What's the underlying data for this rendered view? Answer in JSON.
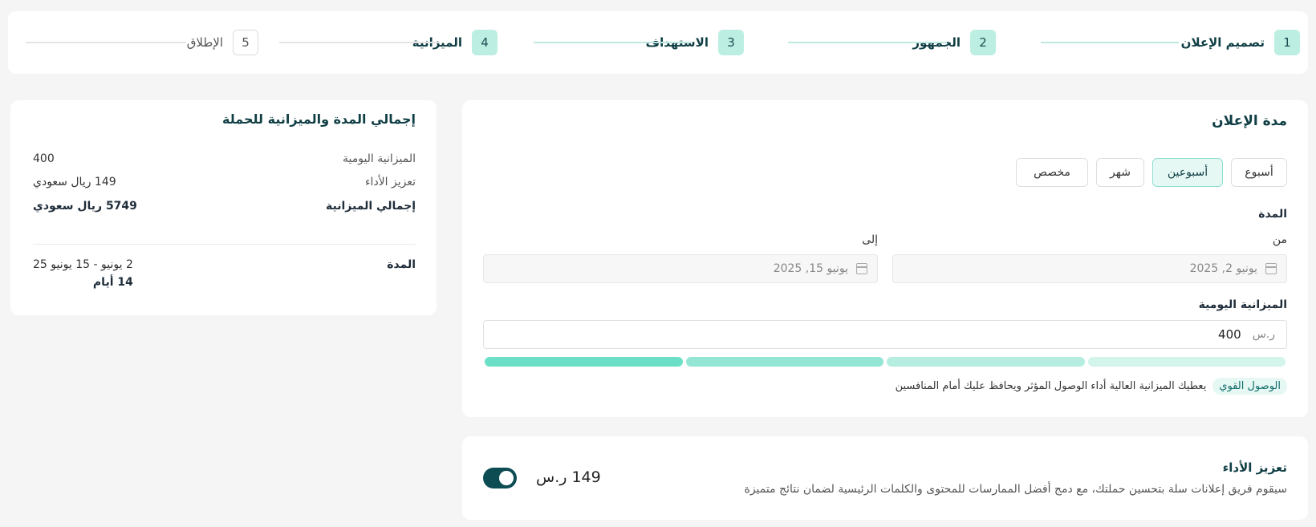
{
  "stepper": {
    "steps": [
      {
        "num": "1",
        "label": "تصميم الإعلان"
      },
      {
        "num": "2",
        "label": "الجمهور"
      },
      {
        "num": "3",
        "label": "الاستهداف"
      },
      {
        "num": "4",
        "label": "الميزانية"
      },
      {
        "num": "5",
        "label": "الإطلاق"
      }
    ]
  },
  "duration": {
    "title": "مدة الإعلان",
    "options": [
      "أسبوع",
      "أسبوعين",
      "شهر",
      "مخصص"
    ],
    "selected": "أسبوعين",
    "period_label": "المدة",
    "from_label": "من",
    "to_label": "إلى",
    "from_value": "يونيو 2, 2025",
    "to_value": "يونيو 15, 2025",
    "daily_budget_label": "الميزانية اليومية",
    "currency": "ر.س",
    "daily_budget_value": "400",
    "reach_badge": "الوصول القوي",
    "reach_hint": "يعطيك الميزانية العالية أداء الوصول المؤثر ويحافظ عليك أمام المنافسين",
    "bar_colors": [
      "#6be0c6",
      "#93e6d4",
      "#b5eee0",
      "#d3f5ec"
    ]
  },
  "summary": {
    "title": "إجمالي المدة والميزانية للحملة",
    "daily_budget_label": "الميزانية اليومية",
    "daily_budget_value": "400",
    "boost_label": "تعزيز الأداء",
    "boost_value": "149 ريال سعودي",
    "total_label": "إجمالي الميزانية",
    "total_value": "5749 ريال سعودي",
    "period_label": "المدة",
    "period_range": "2 يونيو - 15 يونيو 25",
    "period_days": "14 أيام"
  },
  "boost": {
    "title": "تعزيز الأداء",
    "description": "سيقوم فريق إعلانات سلة بتحسين حملتك، مع دمج أفضل الممارسات للمحتوى والكلمات الرئيسية لضمان نتائج متميزة",
    "price": "149 ر.س",
    "enabled": true
  },
  "colors": {
    "primary": "#0c4c52",
    "accent": "#6be0c6",
    "step_done_bg": "#bdeee2"
  }
}
